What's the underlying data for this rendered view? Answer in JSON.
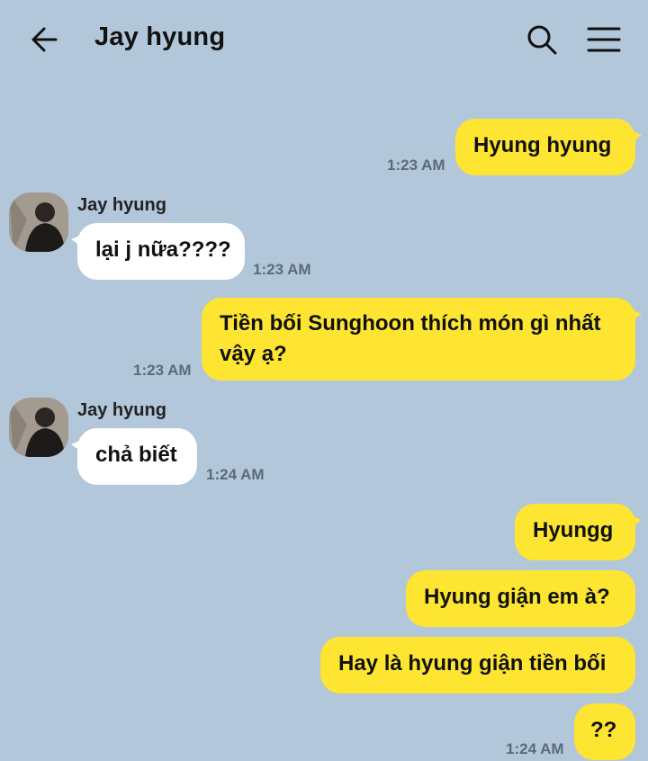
{
  "header": {
    "title": "Jay hyung"
  },
  "icons": {
    "back": "arrow-left-icon",
    "search": "search-icon",
    "menu": "hamburger-menu-icon"
  },
  "colors": {
    "background": "#b2c7da",
    "outgoing_bubble": "#fde532",
    "incoming_bubble": "#ffffff"
  },
  "messages": [
    {
      "dir": "out",
      "text": "Hyung hyung",
      "time": "1:23 AM"
    },
    {
      "dir": "in",
      "sender": "Jay hyung",
      "text": "lại j nữa????",
      "time": "1:23 AM"
    },
    {
      "dir": "out",
      "text_line1": "Tiền bối Sunghoon thích món gì nhất",
      "text_line2": "vậy ạ?",
      "time": "1:23 AM"
    },
    {
      "dir": "in",
      "sender": "Jay hyung",
      "text": "chả biết",
      "time": "1:24 AM"
    },
    {
      "dir": "out",
      "text": "Hyungg"
    },
    {
      "dir": "out",
      "text": "Hyung giận em à?"
    },
    {
      "dir": "out",
      "text": "Hay là hyung giận tiền bối"
    },
    {
      "dir": "out",
      "text": "??",
      "time": "1:24 AM"
    }
  ]
}
